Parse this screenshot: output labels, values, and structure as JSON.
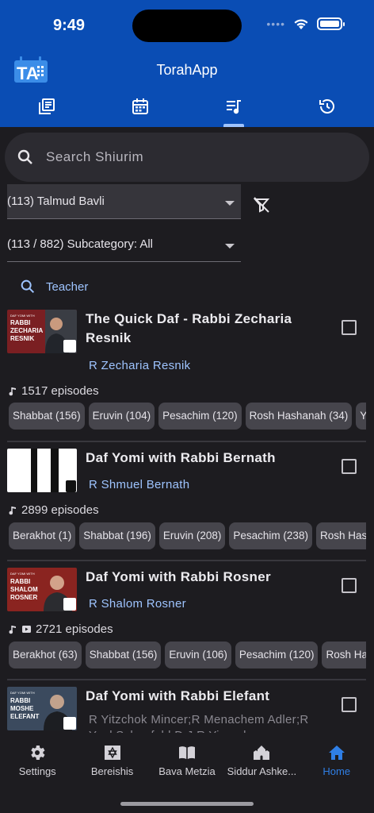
{
  "status": {
    "time": "9:49"
  },
  "app": {
    "title": "TorahApp",
    "logo_text": "TA"
  },
  "top_tabs": [
    {
      "icon": "library-icon"
    },
    {
      "icon": "calendar-icon"
    },
    {
      "icon": "playlist-icon",
      "active": true
    },
    {
      "icon": "history-icon"
    }
  ],
  "search": {
    "placeholder": "Search Shiurim",
    "value": ""
  },
  "filters": {
    "category": "(113) Talmud Bavli",
    "subcategory": "(113 / 882) Subcategory: All",
    "teacher_label": "Teacher"
  },
  "shiurim": [
    {
      "title": "The Quick Daf - Rabbi Zecharia Resnik",
      "author": "R Zecharia Resnik",
      "thumb": {
        "lines": [
          "RABBI",
          "ZECHARIA",
          "RESNIK"
        ],
        "header": "DAF YOMI WITH"
      },
      "episodes": "1517 episodes",
      "chips": [
        "Shabbat (156)",
        "Eruvin (104)",
        "Pesachim (120)",
        "Rosh Hashanah (34)",
        "Yom"
      ]
    },
    {
      "title": "Daf Yomi with Rabbi Bernath",
      "author": "R Shmuel Bernath",
      "episodes": "2899 episodes",
      "chips": [
        "Berakhot (1)",
        "Shabbat (196)",
        "Eruvin (208)",
        "Pesachim (238)",
        "Rosh Hasha"
      ]
    },
    {
      "title": "Daf Yomi with Rabbi Rosner",
      "author": "R Shalom Rosner",
      "thumb": {
        "lines": [
          "RABBI",
          "SHALOM",
          "ROSNER"
        ],
        "header": "DAF YOMI WITH"
      },
      "episodes": "2721 episodes",
      "chips": [
        "Berakhot (63)",
        "Shabbat (156)",
        "Eruvin (106)",
        "Pesachim (120)",
        "Rosh Hash"
      ]
    },
    {
      "title": "Daf Yomi with Rabbi Elefant",
      "author": "R Yitzchok Mincer;R Menachem Adler;R Yoel Schonfeld;D.J;R Yisroel Rokowsky;R",
      "thumb": {
        "lines": [
          "RABBI",
          "MOSHE",
          "ELEFANT"
        ],
        "header": "DAF YOMI WITH"
      }
    }
  ],
  "bottom_nav": [
    {
      "label": "Settings",
      "icon": "gear-icon"
    },
    {
      "label": "Bereishis",
      "icon": "star-of-david-icon"
    },
    {
      "label": "Bava Metzia",
      "icon": "book-icon"
    },
    {
      "label": "Siddur Ashke...",
      "icon": "synagogue-icon"
    },
    {
      "label": "Home",
      "icon": "home-icon",
      "active": true
    }
  ]
}
